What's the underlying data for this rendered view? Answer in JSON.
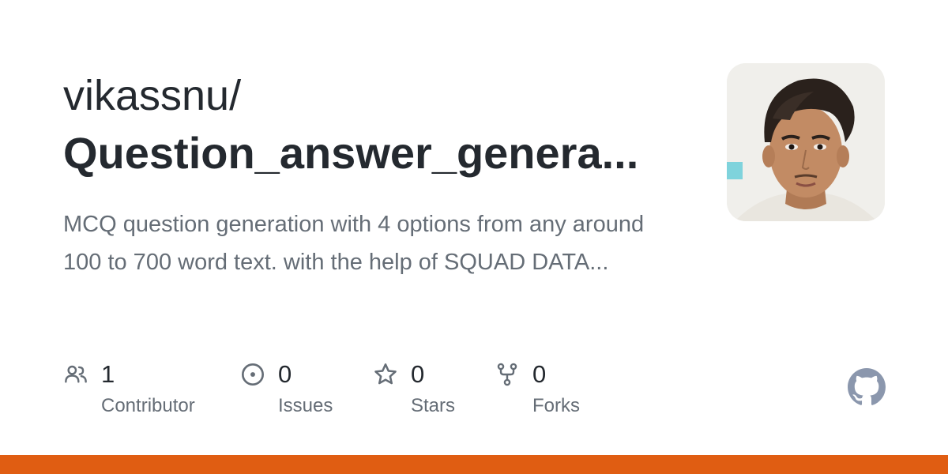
{
  "repository": {
    "owner": "vikassnu/",
    "name": "Question_answer_genera...",
    "description": "MCQ question generation with 4 options from any around 100 to 700 word text. with the help of SQUAD DATA..."
  },
  "stats": [
    {
      "count": "1",
      "label": "Contributor",
      "icon": "people-icon"
    },
    {
      "count": "0",
      "label": "Issues",
      "icon": "issue-icon"
    },
    {
      "count": "0",
      "label": "Stars",
      "icon": "star-icon"
    },
    {
      "count": "0",
      "label": "Forks",
      "icon": "fork-icon"
    }
  ],
  "colors": {
    "text_primary": "#24292f",
    "text_secondary": "#656d76",
    "icon_gray": "#656d76",
    "github_logo": "#8b97ad",
    "language_bar": "#e05d12"
  }
}
